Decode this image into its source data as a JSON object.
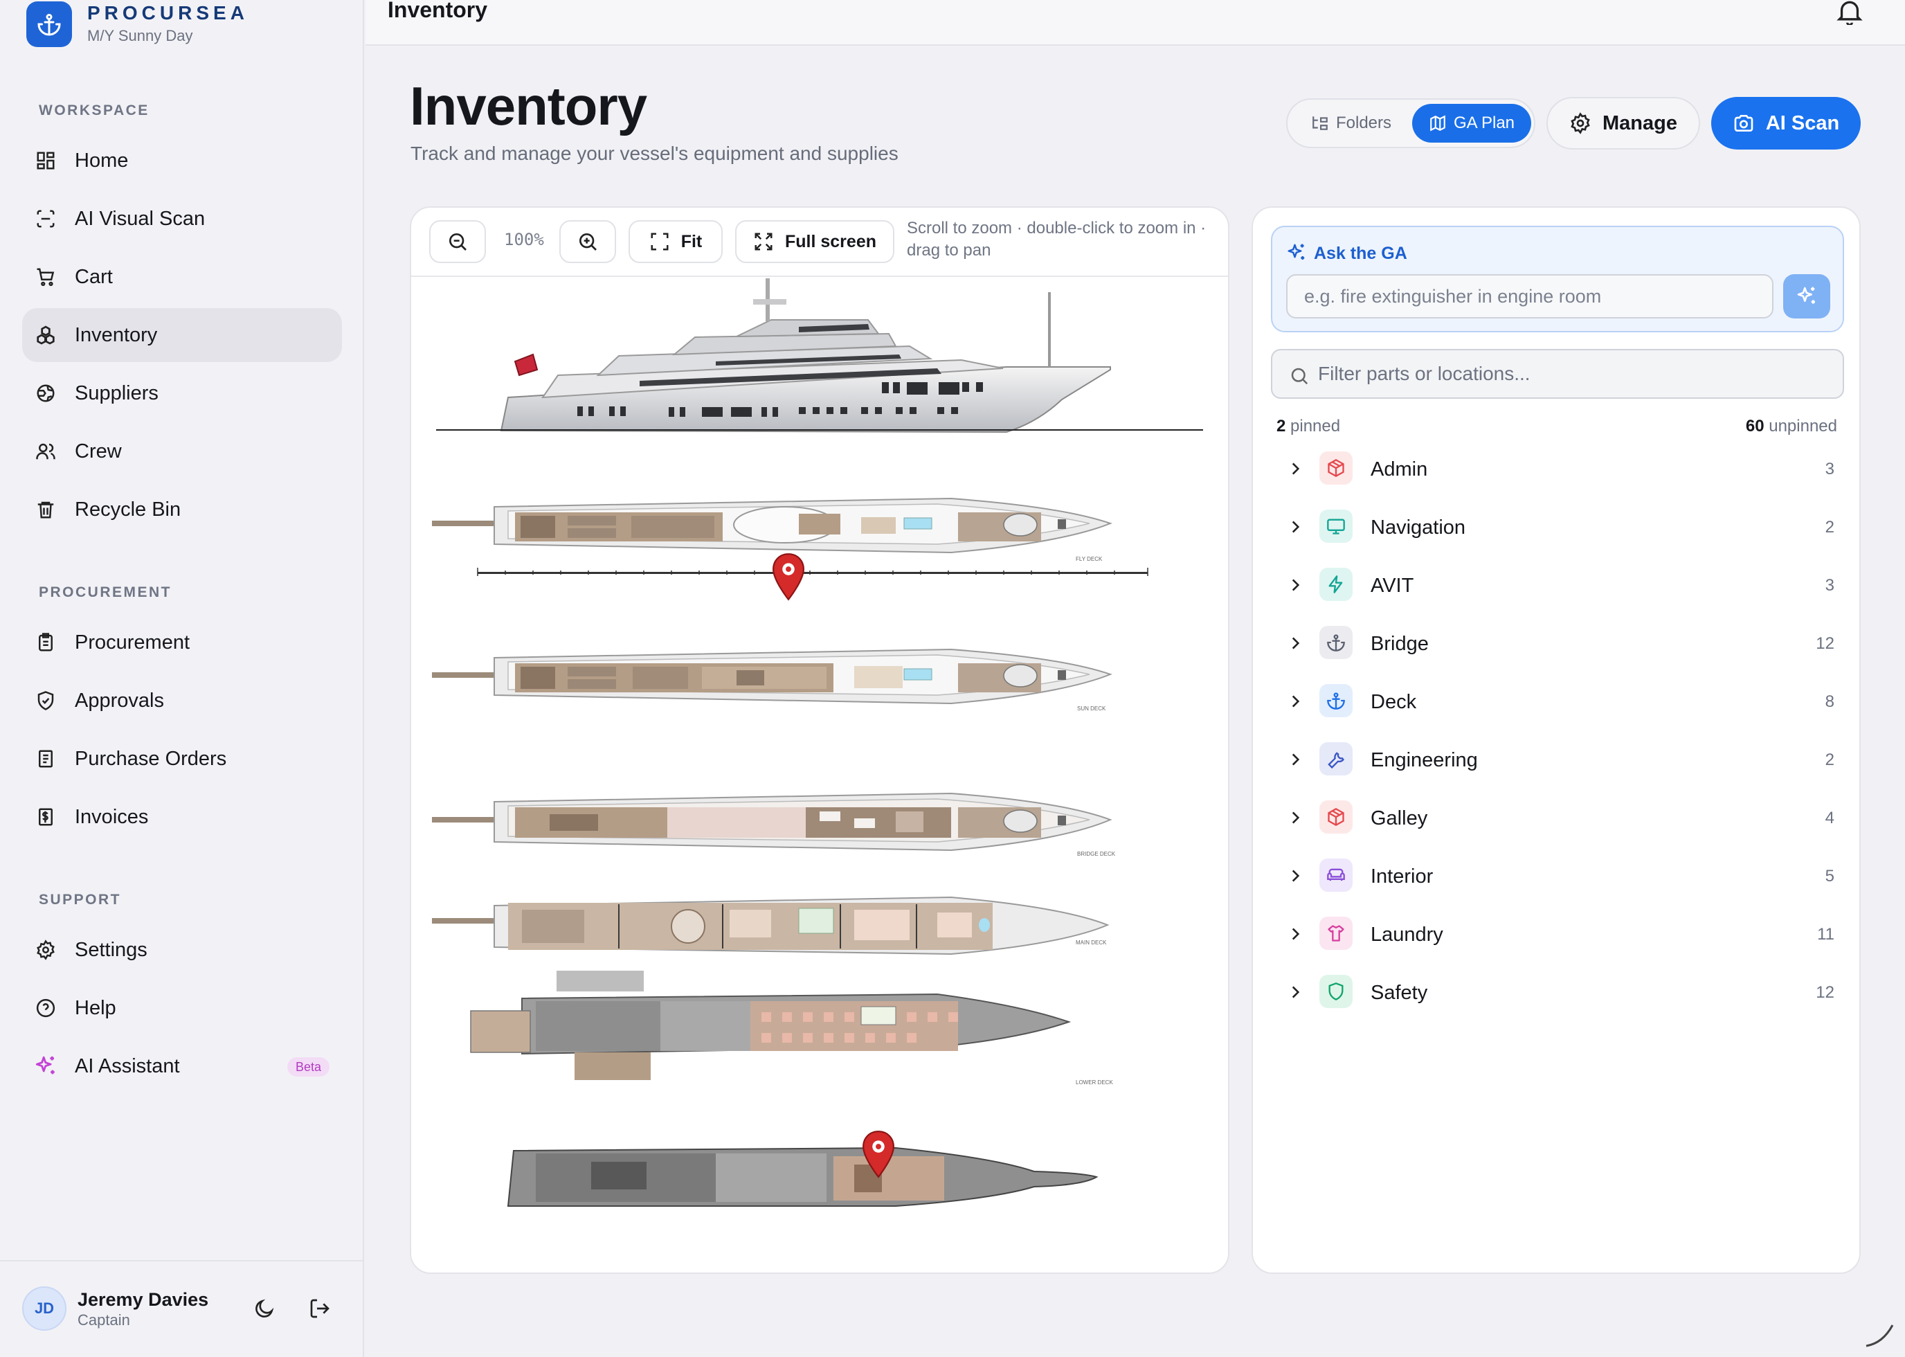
{
  "brand": {
    "name": "PROCURSEA",
    "vessel": "M/Y Sunny Day"
  },
  "sidebar": {
    "sections": {
      "workspace": "WORKSPACE",
      "procurement": "PROCUREMENT",
      "support": "SUPPORT"
    },
    "workspace_items": [
      {
        "label": "Home",
        "icon": "grid-icon"
      },
      {
        "label": "AI Visual Scan",
        "icon": "scan-icon"
      },
      {
        "label": "Cart",
        "icon": "cart-icon"
      },
      {
        "label": "Inventory",
        "icon": "inventory-icon",
        "active": true
      },
      {
        "label": "Suppliers",
        "icon": "globe-icon"
      },
      {
        "label": "Crew",
        "icon": "users-icon"
      },
      {
        "label": "Recycle Bin",
        "icon": "trash-icon"
      }
    ],
    "procurement_items": [
      {
        "label": "Procurement",
        "icon": "clipboard-icon"
      },
      {
        "label": "Approvals",
        "icon": "shield-check-icon"
      },
      {
        "label": "Purchase Orders",
        "icon": "document-icon"
      },
      {
        "label": "Invoices",
        "icon": "invoice-icon"
      }
    ],
    "support_items": [
      {
        "label": "Settings",
        "icon": "gear-icon"
      },
      {
        "label": "Help",
        "icon": "help-icon"
      },
      {
        "label": "AI Assistant",
        "icon": "sparkle-icon",
        "badge": "Beta"
      }
    ]
  },
  "user": {
    "initials": "JD",
    "name": "Jeremy Davies",
    "role": "Captain"
  },
  "topbar": {
    "title": "Inventory"
  },
  "header": {
    "title": "Inventory",
    "subtitle": "Track and manage your vessel's equipment and supplies"
  },
  "view_toggle": {
    "folders": "Folders",
    "ga_plan": "GA Plan",
    "selected": "GA Plan"
  },
  "actions": {
    "manage": "Manage",
    "ai_scan": "AI Scan"
  },
  "map": {
    "zoom": "100%",
    "fit": "Fit",
    "fullscreen": "Full screen",
    "hint": "Scroll to zoom · double-click to zoom in · drag to pan",
    "deck_labels": [
      "FLY DECK",
      "SUN DECK",
      "BRIDGE DECK",
      "MAIN DECK",
      "LOWER DECK"
    ],
    "pinned_markers": 2
  },
  "ask": {
    "title": "Ask the GA",
    "placeholder": "e.g. fire extinguisher in engine room"
  },
  "filter": {
    "placeholder": "Filter parts or locations..."
  },
  "counts": {
    "pinned": "2",
    "pinned_label": "pinned",
    "unpinned": "60",
    "unpinned_label": "unpinned"
  },
  "categories": [
    {
      "name": "Admin",
      "count": "3",
      "icon": "box-icon",
      "color": "#e5484d",
      "bg": "#fde8e8"
    },
    {
      "name": "Navigation",
      "count": "2",
      "icon": "monitor-icon",
      "color": "#12a594",
      "bg": "#dff5f1"
    },
    {
      "name": "AVIT",
      "count": "3",
      "icon": "bolt-icon",
      "color": "#12a594",
      "bg": "#dff5f1"
    },
    {
      "name": "Bridge",
      "count": "12",
      "icon": "anchor-icon",
      "color": "#5b6170",
      "bg": "#ececf0"
    },
    {
      "name": "Deck",
      "count": "8",
      "icon": "anchor-icon",
      "color": "#1d6fe8",
      "bg": "#e3eefd"
    },
    {
      "name": "Engineering",
      "count": "2",
      "icon": "wrench-icon",
      "color": "#3a56c5",
      "bg": "#e6e9f8"
    },
    {
      "name": "Galley",
      "count": "4",
      "icon": "box-icon",
      "color": "#e5484d",
      "bg": "#fde8e8"
    },
    {
      "name": "Interior",
      "count": "5",
      "icon": "sofa-icon",
      "color": "#8a4fd8",
      "bg": "#efe7fb"
    },
    {
      "name": "Laundry",
      "count": "11",
      "icon": "shirt-icon",
      "color": "#d6409f",
      "bg": "#fbe5f1"
    },
    {
      "name": "Safety",
      "count": "12",
      "icon": "shield-icon",
      "color": "#12a56a",
      "bg": "#dff5ea"
    }
  ],
  "colors": {
    "accent": "#1a72ee",
    "pin": "#d42a2a",
    "brand_navy": "#163a78"
  }
}
